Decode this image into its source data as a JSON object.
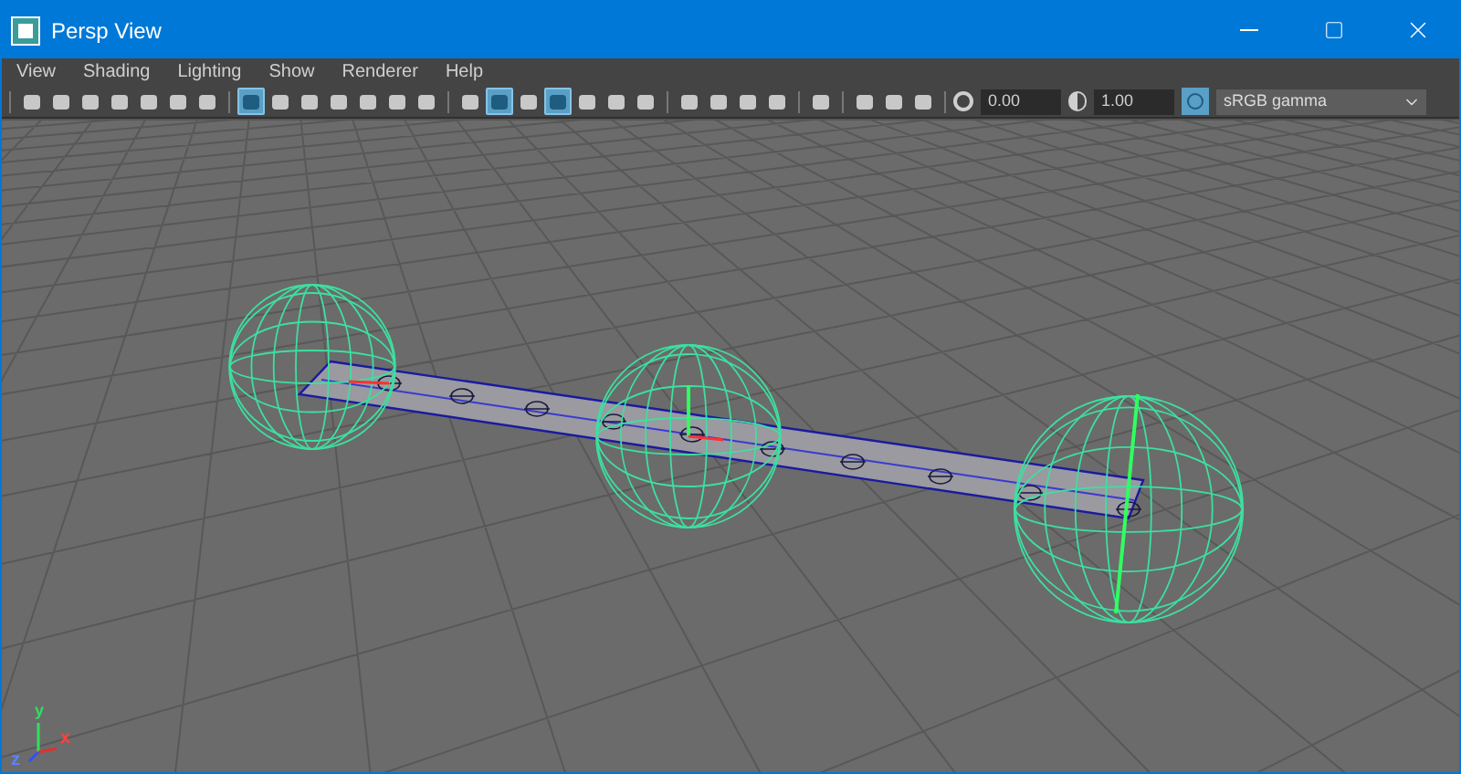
{
  "window": {
    "title": "Persp View"
  },
  "menu": [
    {
      "label": "View"
    },
    {
      "label": "Shading"
    },
    {
      "label": "Lighting"
    },
    {
      "label": "Show"
    },
    {
      "label": "Renderer"
    },
    {
      "label": "Help"
    }
  ],
  "toolbar_groups": [
    [
      {
        "selected": false
      },
      {
        "selected": false
      },
      {
        "selected": false
      },
      {
        "selected": false
      },
      {
        "selected": false
      },
      {
        "selected": false
      },
      {
        "selected": false
      }
    ],
    [
      {
        "selected": true
      },
      {
        "selected": false
      },
      {
        "selected": false
      },
      {
        "selected": false
      },
      {
        "selected": false
      },
      {
        "selected": false
      },
      {
        "selected": false
      }
    ],
    [
      {
        "selected": false
      },
      {
        "selected": true
      },
      {
        "selected": false
      },
      {
        "selected": true
      },
      {
        "selected": false
      },
      {
        "selected": false
      },
      {
        "selected": false
      }
    ],
    [
      {
        "selected": false
      },
      {
        "selected": false
      },
      {
        "selected": false
      },
      {
        "selected": false
      }
    ],
    [
      {
        "selected": false
      }
    ],
    [
      {
        "selected": false
      },
      {
        "selected": false
      },
      {
        "selected": false
      }
    ]
  ],
  "exposure": {
    "value": "0.00"
  },
  "gamma": {
    "value": "1.00"
  },
  "color_space": {
    "value": "sRGB gamma"
  },
  "axis_labels": [
    {
      "label": "y"
    },
    {
      "label": "x"
    },
    {
      "label": "z"
    }
  ]
}
